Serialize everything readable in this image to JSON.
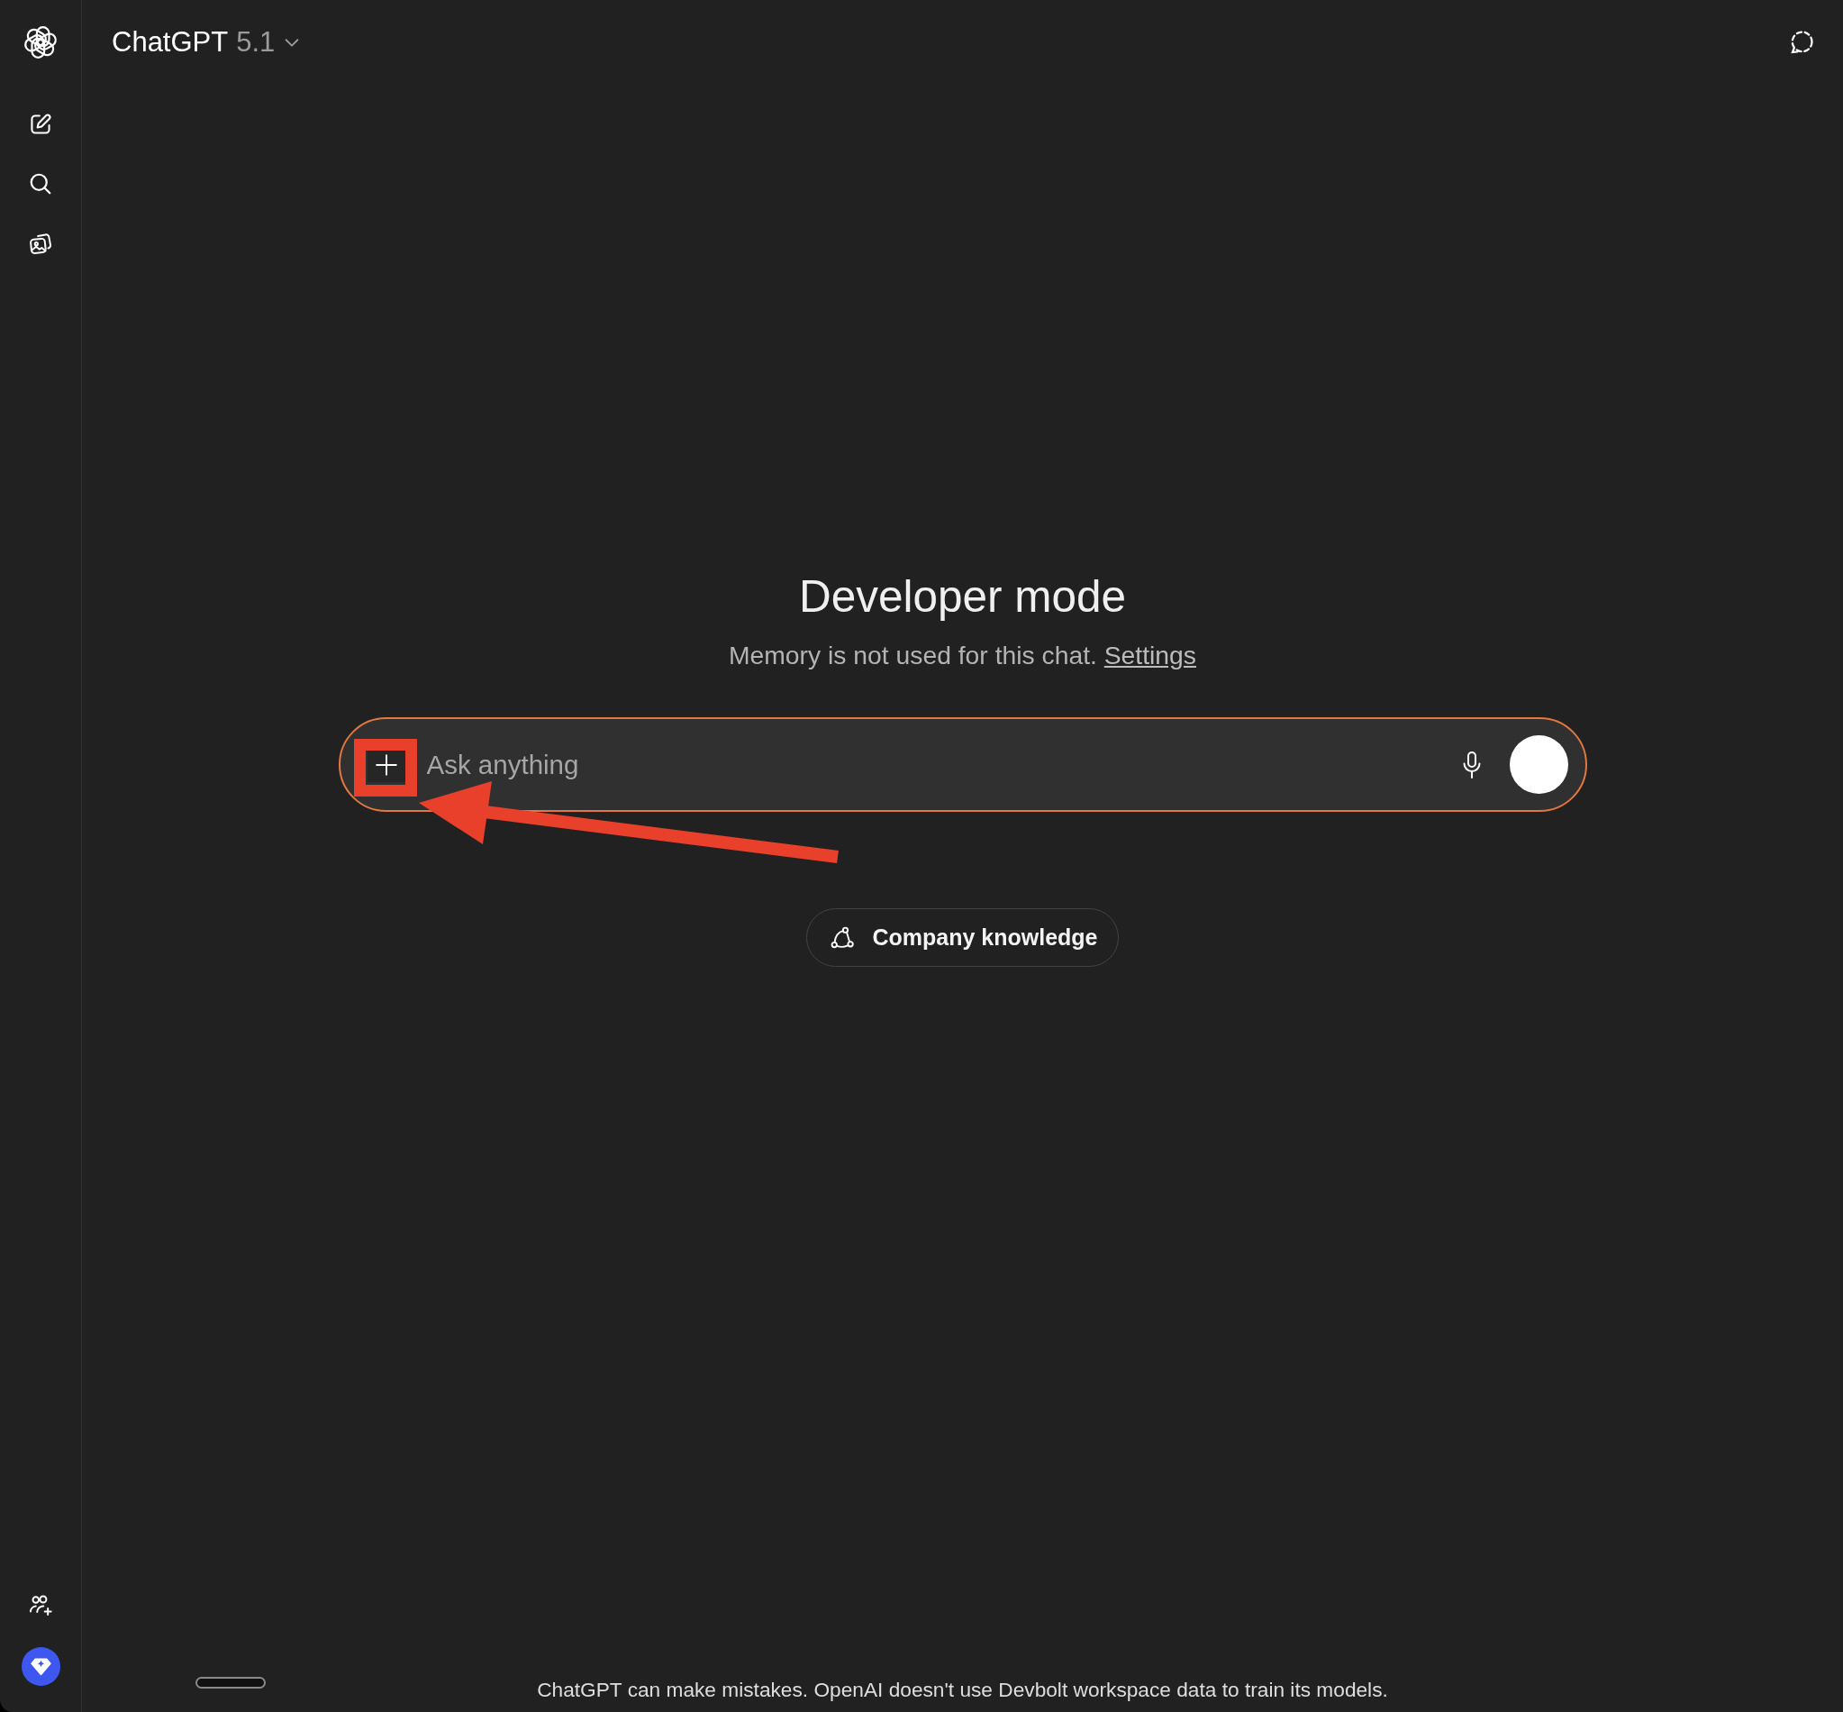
{
  "header": {
    "model_name": "ChatGPT",
    "model_version": "5.1"
  },
  "intro": {
    "title": "Developer mode",
    "notice": "Memory is not used for this chat.",
    "notice_link": "Settings"
  },
  "composer": {
    "placeholder": "Ask anything"
  },
  "knowledge_button": {
    "label": "Company knowledge"
  },
  "footer": {
    "disclaimer": "ChatGPT can make mistakes. OpenAI doesn't use Devbolt workspace data to train its models."
  }
}
